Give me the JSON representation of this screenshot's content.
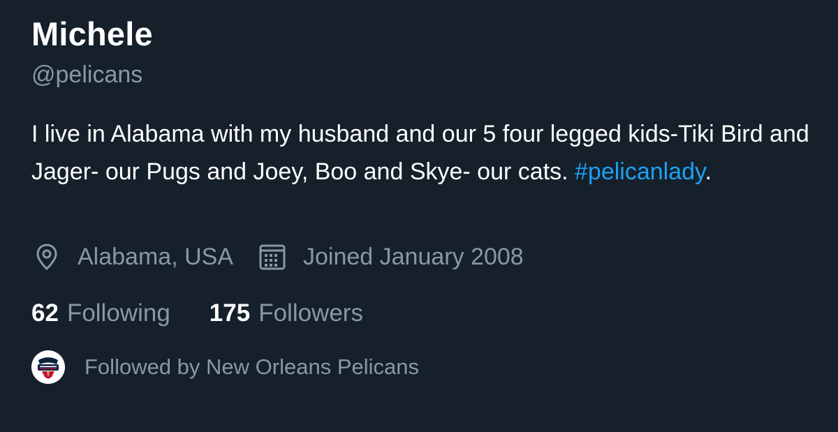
{
  "profile": {
    "display_name": "Michele",
    "handle": "@pelicans",
    "bio": {
      "text": "I live in Alabama with my husband and our 5 four legged kids-Tiki Bird and Jager- our Pugs and Joey, Boo and Skye- our cats. ",
      "hashtag": "#pelicanlady",
      "trailing": "."
    },
    "location": {
      "icon": "location-pin-icon",
      "text": "Alabama, USA"
    },
    "joined": {
      "icon": "calendar-icon",
      "text": "Joined January 2008"
    },
    "following": {
      "count": "62",
      "label": "Following"
    },
    "followers": {
      "count": "175",
      "label": "Followers"
    },
    "followed_by": {
      "avatar_icon": "new-orleans-pelicans-logo",
      "text": "Followed by New Orleans Pelicans"
    }
  },
  "colors": {
    "background": "#15202b",
    "primary_text": "#ffffff",
    "secondary_text": "#8899a6",
    "link": "#1da1f2"
  }
}
